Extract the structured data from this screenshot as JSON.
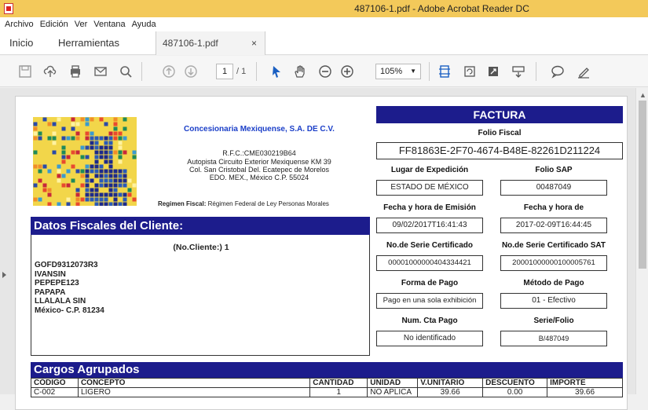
{
  "window": {
    "title": "487106-1.pdf - Adobe Acrobat Reader DC"
  },
  "menu": [
    "Archivo",
    "Edición",
    "Ver",
    "Ventana",
    "Ayuda"
  ],
  "tabs": {
    "home": "Inicio",
    "tools": "Herramientas",
    "document": "487106-1.pdf",
    "close": "×"
  },
  "toolbar": {
    "page_current": "1",
    "page_total": "/ 1",
    "zoom": "105%"
  },
  "doc": {
    "company_name": "Concesionaria Mexiquense, S.A. DE C.V.",
    "rfc": "R.F.C.:CME030219B64",
    "address1": "Autopista Circuito Exterior Mexiquense KM 39",
    "address2": "Col. San Cristobal Del. Ecatepec de Morelos",
    "address3": "EDO. MEX., México C.P. 55024",
    "regimen_label": "Regimen Fiscal:",
    "regimen_value": "Régimen Federal de Ley Personas Morales",
    "factura_title": "FACTURA",
    "folio_fiscal_label": "Folio Fiscal",
    "folio_fiscal_value": "FF81863E-2F70-4674-B48E-82261D211224",
    "lugar_label": "Lugar de Expedición",
    "lugar_value": "ESTADO DE MÉXICO",
    "folio_sap_label": "Folio SAP",
    "folio_sap_value": "00487049",
    "fecha_emision_label": "Fecha y hora de Emisión",
    "fecha_emision_value": "09/02/2017T16:41:43",
    "fecha_cert_label": "Fecha y hora de",
    "fecha_cert_value": "2017-02-09T16:44:45",
    "serie_cert_label": "No.de Serie Certificado",
    "serie_cert_value": "00001000000404334421",
    "serie_sat_label": "No.de Serie Certificado SAT",
    "serie_sat_value": "20001000000100005761",
    "forma_pago_label": "Forma de Pago",
    "forma_pago_value": "Pago en una sola exhibición",
    "metodo_pago_label": "Método de Pago",
    "metodo_pago_value": "01 - Efectivo",
    "num_cta_label": "Num. Cta Pago",
    "num_cta_value": "No identificado",
    "serie_folio_label": "Serie/Folio",
    "serie_folio_value": "B/487049",
    "client_header": "Datos Fiscales del Cliente:",
    "client_no": "(No.Cliente:) 1",
    "client_lines": [
      "GOFD9312073R3",
      "IVANSIN",
      "PEPEPE123",
      "PAPAPA",
      "LLALALA SIN",
      "México- C.P. 81234"
    ],
    "cargos_header": "Cargos Agrupados",
    "table_headers": [
      "CÓDIGO",
      "CONCEPTO",
      "CANTIDAD",
      "UNIDAD",
      "V.UNITARIO",
      "DESCUENTO",
      "IMPORTE"
    ],
    "table_rows": [
      [
        "C-002",
        "LIGERO",
        "1",
        "NO APLICA",
        "39.66",
        "0.00",
        "39.66"
      ]
    ]
  },
  "colors": {
    "titlebar": "#f3c95a",
    "navy": "#1c1c8c",
    "company_blue": "#1a3ec8"
  }
}
